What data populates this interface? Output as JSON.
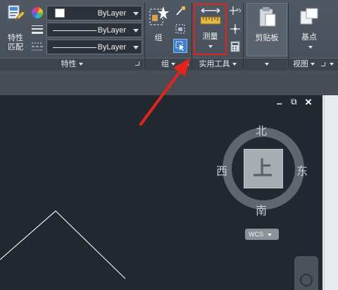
{
  "properties_panel": {
    "match_button_label": "特性\n匹配",
    "color_combo_value": "ByLayer",
    "linetype_combo_value": "ByLayer",
    "lineweight_combo_value": "ByLayer",
    "footer_label": "特性"
  },
  "group_panel": {
    "group_button_label": "组",
    "footer_label": "组"
  },
  "utilities_panel": {
    "measure_button_label": "测量",
    "footer_label": "实用工具"
  },
  "clipboard_panel": {
    "paste_button_label": "剪贴板"
  },
  "view_panel": {
    "base_button_label": "基点",
    "footer_label": "视图"
  },
  "viewport_controls": {
    "minimize": "–",
    "restore": "⧉",
    "close": "×"
  },
  "viewcube": {
    "north": "北",
    "south": "南",
    "east": "东",
    "west": "西",
    "face": "上",
    "wcs_label": "WCS"
  },
  "colors": {
    "highlight_box": "#e0261c",
    "annotation_arrow": "#e0261c",
    "drawing_background": "#212830",
    "ribbon_background": "#4b535e"
  }
}
